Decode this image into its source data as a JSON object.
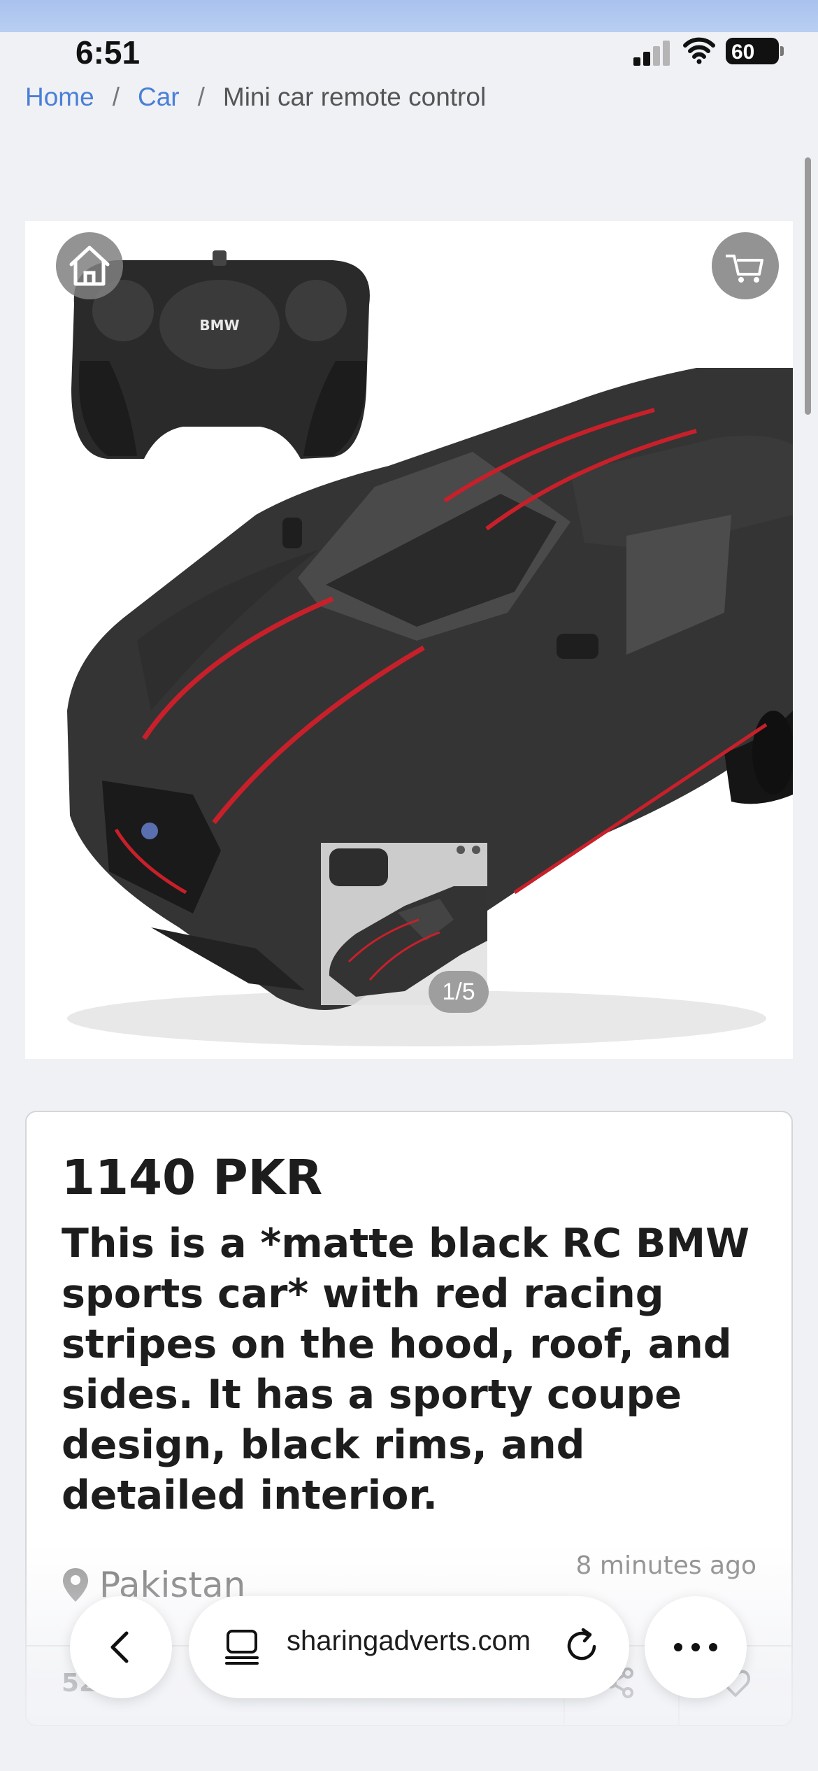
{
  "status_bar": {
    "time": "6:51",
    "battery": "60"
  },
  "breadcrumb": {
    "items": [
      "Home",
      "Car"
    ],
    "separator": "/",
    "current": "Mini car remote control"
  },
  "gallery": {
    "counter": "1/5",
    "home_icon": "home-icon",
    "cart_icon": "cart-icon"
  },
  "product": {
    "price": "1140 PKR",
    "description": "This is a *matte black RC BMW sports car* with red racing stripes on the hood, roof, and sides. It has a sporty coupe design, black rims, and detailed interior.",
    "location": "Pakistan",
    "posted": "8 minutes ago",
    "views": "52"
  },
  "browser": {
    "url": "sharingadverts.com"
  },
  "colors": {
    "link": "#4a7fd6",
    "background": "#f0f1f5",
    "stripe": "#c8202a"
  }
}
